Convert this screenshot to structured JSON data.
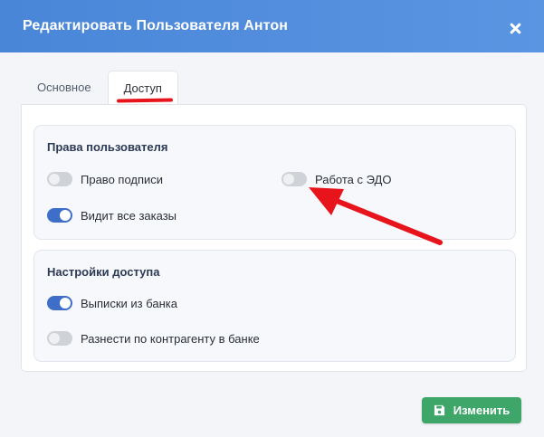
{
  "dialog": {
    "title": "Редактировать Пользователя Антон"
  },
  "tabs": [
    {
      "label": "Основное",
      "active": false
    },
    {
      "label": "Доступ",
      "active": true
    }
  ],
  "sections": {
    "user_rights": {
      "title": "Права пользователя",
      "toggles": {
        "signature": {
          "label": "Право подписи",
          "on": false
        },
        "edo": {
          "label": "Работа с ЭДО",
          "on": false
        },
        "all_orders": {
          "label": "Видит все заказы",
          "on": true
        }
      }
    },
    "access_settings": {
      "title": "Настройки доступа",
      "toggles": {
        "bank_statements": {
          "label": "Выписки из банка",
          "on": true
        },
        "allocate_counterparty": {
          "label": "Разнести по контрагенту в банке",
          "on": false
        }
      }
    }
  },
  "footer": {
    "save_label": "Изменить"
  },
  "colors": {
    "header": "#4a86d8",
    "toggle_on": "#3f6ec9",
    "toggle_off": "#cfd3d8",
    "save_button": "#3fa66a",
    "annotation": "#e8141c"
  },
  "icons": {
    "close": "close-icon",
    "save": "floppy-disk-icon"
  }
}
